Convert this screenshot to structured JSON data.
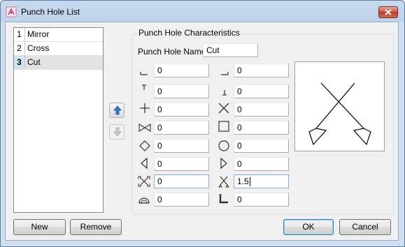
{
  "window": {
    "title": "Punch Hole List"
  },
  "list": {
    "items": [
      {
        "index": "1",
        "name": "Mirror"
      },
      {
        "index": "2",
        "name": "Cross"
      },
      {
        "index": "3",
        "name": "Cut"
      }
    ],
    "selected_index": 2
  },
  "characteristics": {
    "group_label": "Punch Hole Characteristics",
    "name_label": "Punch Hole Name:",
    "name_value": "Cut",
    "fields": [
      {
        "icon": "top-left-corner-icon",
        "value": "0"
      },
      {
        "icon": "top-right-corner-icon",
        "value": "0"
      },
      {
        "icon": "t-shape-icon",
        "value": "0"
      },
      {
        "icon": "inverted-t-icon",
        "value": "0"
      },
      {
        "icon": "plus-icon",
        "value": "0"
      },
      {
        "icon": "x-cross-icon",
        "value": "0"
      },
      {
        "icon": "bowtie-icon",
        "value": "0"
      },
      {
        "icon": "square-icon",
        "value": "0"
      },
      {
        "icon": "diamond-icon",
        "value": "0"
      },
      {
        "icon": "circle-icon",
        "value": "0"
      },
      {
        "icon": "triangle-left-icon",
        "value": "0"
      },
      {
        "icon": "triangle-right-icon",
        "value": "0"
      },
      {
        "icon": "scissors-cut-icon",
        "value": "0"
      },
      {
        "icon": "scissors-cut-small-icon",
        "value": "1.5"
      },
      {
        "icon": "semicircle-icon",
        "value": "0"
      },
      {
        "icon": "l-corner-icon",
        "value": "0"
      }
    ]
  },
  "buttons": {
    "new": "New",
    "remove": "Remove",
    "ok": "OK",
    "cancel": "Cancel"
  }
}
